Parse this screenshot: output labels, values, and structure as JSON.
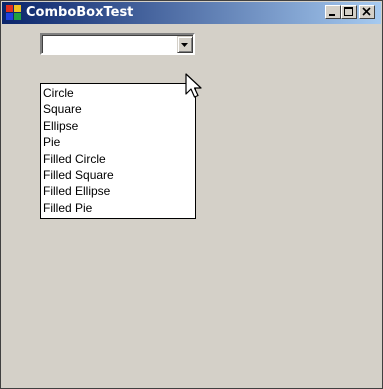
{
  "window": {
    "title": "ComboBoxTest",
    "colors": {
      "title_start": "#0a246a",
      "title_end": "#a6caf0",
      "face": "#d4d0c8"
    }
  },
  "title_buttons": [
    "minimize-icon",
    "maximize-icon",
    "close-icon"
  ],
  "combo": {
    "value": "",
    "arrow_icon": "chevron-down-icon"
  },
  "dropdown": {
    "items": [
      "Circle",
      "Square",
      "Ellipse",
      "Pie",
      "Filled Circle",
      "Filled Square",
      "Filled Ellipse",
      "Filled Pie"
    ]
  },
  "cursor_icon": "mouse-pointer-icon"
}
